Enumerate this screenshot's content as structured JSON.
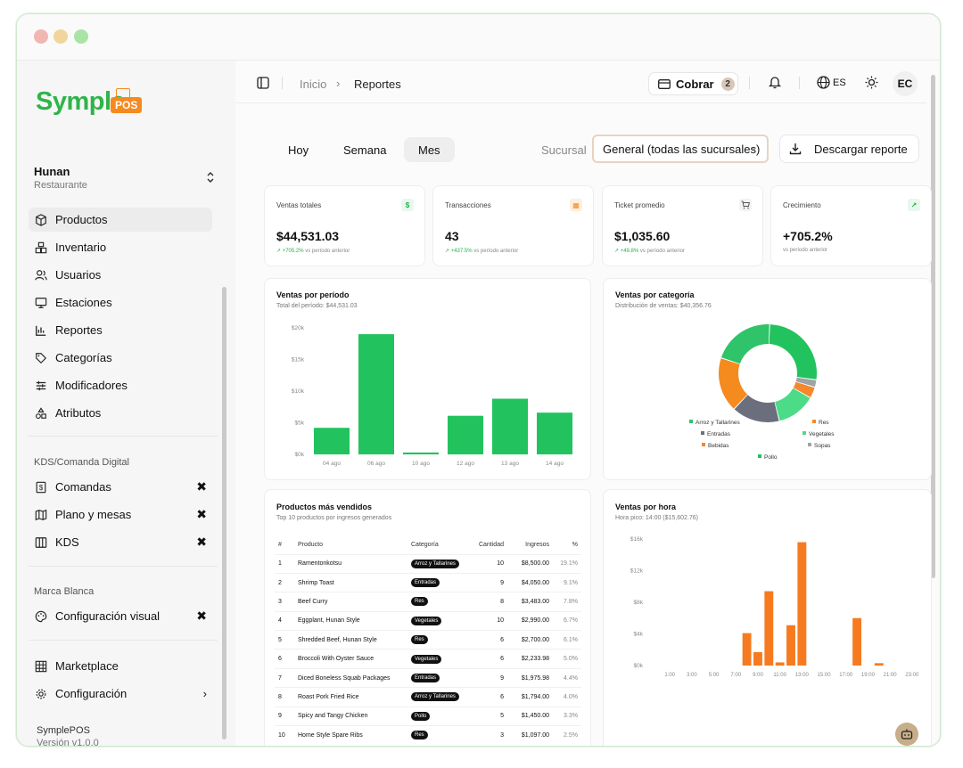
{
  "brand": {
    "name": "Symple",
    "tag": "POS"
  },
  "org": {
    "name": "Hunan",
    "type": "Restaurante"
  },
  "sidebar": {
    "items": [
      {
        "label": "Productos",
        "icon": "box-icon"
      },
      {
        "label": "Inventario",
        "icon": "boxes-icon"
      },
      {
        "label": "Usuarios",
        "icon": "users-icon"
      },
      {
        "label": "Estaciones",
        "icon": "monitor-icon"
      },
      {
        "label": "Reportes",
        "icon": "bar-chart-icon"
      },
      {
        "label": "Categorías",
        "icon": "tag-icon"
      },
      {
        "label": "Modificadores",
        "icon": "sliders-icon"
      },
      {
        "label": "Atributos",
        "icon": "shapes-icon"
      }
    ],
    "kds_title": "KDS/Comanda Digital",
    "kds_items": [
      {
        "label": "Comandas",
        "icon": "receipt-icon"
      },
      {
        "label": "Plano y mesas",
        "icon": "map-icon"
      },
      {
        "label": "KDS",
        "icon": "columns-icon"
      }
    ],
    "brand_title": "Marca Blanca",
    "brand_items": [
      {
        "label": "Configuración visual",
        "icon": "palette-icon"
      }
    ],
    "extra_items": [
      {
        "label": "Marketplace",
        "icon": "grid-icon"
      },
      {
        "label": "Configuración",
        "icon": "gear-icon"
      }
    ],
    "footer_name": "SymplePOS",
    "footer_version": "Versión v1.0.0"
  },
  "topbar": {
    "crumb_home": "Inicio",
    "crumb_current": "Reportes",
    "cobrar_label": "Cobrar",
    "cobrar_count": "2",
    "lang": "ES",
    "user_initials": "EC"
  },
  "filters": {
    "periods": [
      "Hoy",
      "Semana",
      "Mes"
    ],
    "active_period": "Mes",
    "branch_label": "Sucursal",
    "branch_value": "General (todas las sucursales)",
    "download_label": "Descargar reporte"
  },
  "kpis": [
    {
      "title": "Ventas totales",
      "value": "$44,531.03",
      "delta": "↗ +705.2%",
      "delta_text": " vs período anterior",
      "icon": "$",
      "icon_color": "#22b14c"
    },
    {
      "title": "Transacciones",
      "value": "43",
      "delta": "↗ +437.5%",
      "delta_text": " vs período anterior",
      "icon": "▦",
      "icon_color": "#f58a1f"
    },
    {
      "title": "Ticket promedio",
      "value": "$1,035.60",
      "delta": "↗ +49.8%",
      "delta_text": " vs período anterior",
      "icon": "🛒",
      "icon_color": "#555555"
    },
    {
      "title": "Crecimiento",
      "value": "+705.2%",
      "delta": "",
      "delta_text": "vs período anterior",
      "icon": "↗",
      "icon_color": "#22b14c"
    }
  ],
  "chart_data": [
    {
      "type": "bar",
      "title": "Ventas por período",
      "subtitle": "Total del período: $44,531.03",
      "categories": [
        "04 ago",
        "06 ago",
        "10 ago",
        "12 ago",
        "13 ago",
        "14 ago"
      ],
      "values": [
        4200,
        19000,
        300,
        6100,
        8800,
        6600
      ],
      "ylim": [
        0,
        20000
      ],
      "yticks": [
        "$0k",
        "$5k",
        "$10k",
        "$15k",
        "$20k"
      ],
      "color": "#22c35e"
    },
    {
      "type": "pie",
      "title": "Ventas por categoría",
      "subtitle": "Distribución de ventas: $40,356.76",
      "labels": [
        "Arroz y Tallarines",
        "Res",
        "Entradas",
        "Vegetales",
        "Bebidas",
        "Sopas",
        "Pollo"
      ],
      "slice_order": [
        "Pollo",
        "Pollo2",
        "Sopas",
        "Bebidas",
        "Res",
        "Vegetales",
        "Entradas",
        "Arroz y Tallarines"
      ],
      "values": [
        10700,
        1500,
        1000,
        5200,
        6400,
        7300,
        8300
      ],
      "slice_values": [
        10700,
        1000,
        1500,
        5200,
        6400,
        7300,
        8300
      ],
      "colors": {
        "Arroz y Tallarines": "#2fc36a",
        "Res": "#f58a1f",
        "Entradas": "#6b6f7d",
        "Vegetales": "#4cdb86",
        "Bebidas": "#f6872b",
        "Sopas": "#9ea3a8",
        "Pollo": "#22c35e"
      }
    },
    {
      "type": "bar",
      "title": "Ventas por hora",
      "subtitle": "Hora pico: 14:00 ($15,602.76)",
      "categories": [
        "1:00",
        "2:00",
        "3:00",
        "4:00",
        "5:00",
        "6:00",
        "7:00",
        "8:00",
        "9:00",
        "10:00",
        "11:00",
        "12:00",
        "13:00",
        "14:00",
        "15:00",
        "16:00",
        "17:00",
        "18:00",
        "19:00",
        "20:00",
        "21:00",
        "22:00",
        "23:00"
      ],
      "xticks": [
        "1:00",
        "3:00",
        "5:00",
        "7:00",
        "9:00",
        "11:00",
        "13:00",
        "15:00",
        "17:00",
        "19:00",
        "21:00",
        "23:00"
      ],
      "values": [
        0,
        0,
        0,
        0,
        0,
        0,
        0,
        4100,
        1700,
        9400,
        400,
        5100,
        15600,
        0,
        0,
        0,
        0,
        6000,
        0,
        300,
        0,
        0,
        0
      ],
      "ylim": [
        0,
        16000
      ],
      "yticks": [
        "$0k",
        "$4k",
        "$8k",
        "$12k",
        "$16k"
      ],
      "color": "#f67a1f"
    }
  ],
  "top_products": {
    "title": "Productos más vendidos",
    "subtitle": "Top 10 productos por ingresos generados",
    "headers": [
      "#",
      "Producto",
      "Categoría",
      "Cantidad",
      "Ingresos",
      "%"
    ],
    "rows": [
      [
        "1",
        "Ramentonkotsu",
        "Arroz y Tallarines",
        "10",
        "$8,500.00",
        "19.1%"
      ],
      [
        "2",
        "Shrimp Toast",
        "Entradas",
        "9",
        "$4,050.00",
        "9.1%"
      ],
      [
        "3",
        "Beef Curry",
        "Res",
        "8",
        "$3,483.00",
        "7.8%"
      ],
      [
        "4",
        "Eggplant, Hunan Style",
        "Vegetales",
        "10",
        "$2,990.00",
        "6.7%"
      ],
      [
        "5",
        "Shredded Beef, Hunan Style",
        "Res",
        "6",
        "$2,700.00",
        "6.1%"
      ],
      [
        "6",
        "Broccoli With Oyster Sauce",
        "Vegetales",
        "6",
        "$2,233.98",
        "5.0%"
      ],
      [
        "7",
        "Diced Boneless Squab Packages",
        "Entradas",
        "9",
        "$1,975.98",
        "4.4%"
      ],
      [
        "8",
        "Roast Pork Fried Rice",
        "Arroz y Tallarines",
        "6",
        "$1,794.00",
        "4.0%"
      ],
      [
        "9",
        "Spicy and Tangy Chicken",
        "Pollo",
        "5",
        "$1,450.00",
        "3.3%"
      ],
      [
        "10",
        "Home Style Spare Ribs",
        "Res",
        "3",
        "$1,097.00",
        "2.5%"
      ]
    ]
  }
}
